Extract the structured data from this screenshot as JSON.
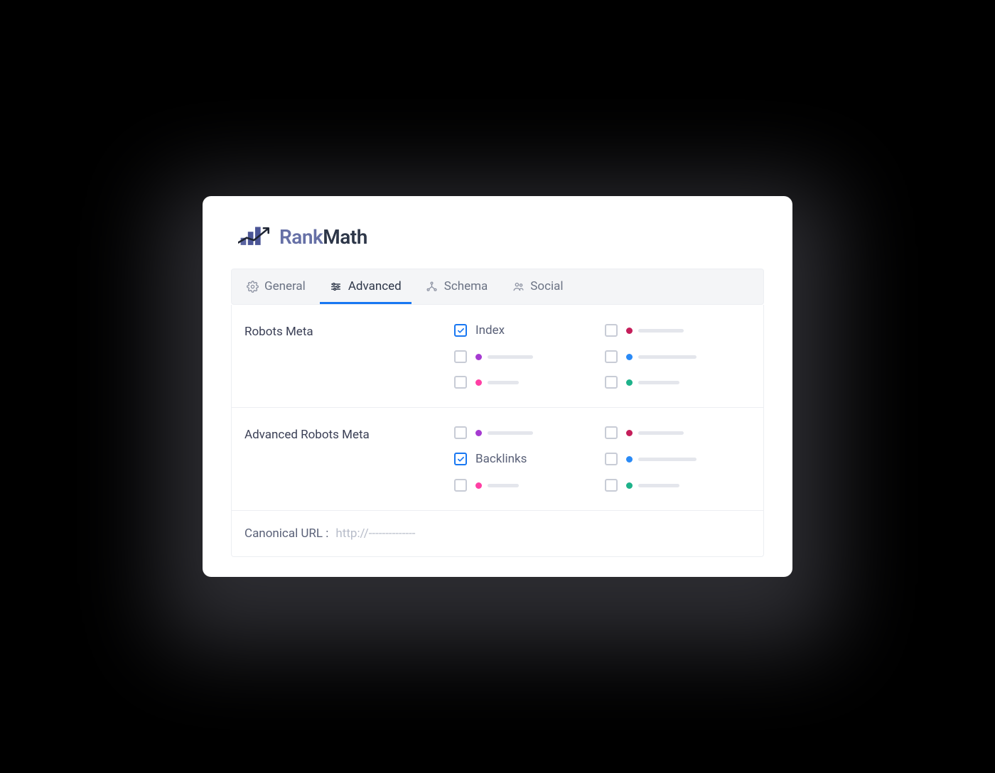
{
  "brand": {
    "rank": "Rank",
    "math": "Math"
  },
  "tabs": {
    "general": "General",
    "advanced": "Advanced",
    "schema": "Schema",
    "social": "Social"
  },
  "sections": {
    "robots": {
      "label": "Robots Meta",
      "items": {
        "left": [
          {
            "type": "text",
            "label": "Index",
            "checked": true
          },
          {
            "type": "ph",
            "dot": "#a63bd1",
            "bar": 64,
            "checked": false
          },
          {
            "type": "ph",
            "dot": "#ff3fa4",
            "bar": 44,
            "checked": false
          }
        ],
        "right": [
          {
            "type": "ph",
            "dot": "#c51e5a",
            "bar": 64,
            "checked": false
          },
          {
            "type": "ph",
            "dot": "#2a8af6",
            "bar": 82,
            "checked": false
          },
          {
            "type": "ph",
            "dot": "#1eb28a",
            "bar": 58,
            "checked": false
          }
        ]
      }
    },
    "advRobots": {
      "label": "Advanced Robots Meta",
      "items": {
        "left": [
          {
            "type": "ph",
            "dot": "#a63bd1",
            "bar": 64,
            "checked": false
          },
          {
            "type": "text",
            "label": "Backlinks",
            "checked": true
          },
          {
            "type": "ph",
            "dot": "#ff3fa4",
            "bar": 44,
            "checked": false
          }
        ],
        "right": [
          {
            "type": "ph",
            "dot": "#c51e5a",
            "bar": 64,
            "checked": false
          },
          {
            "type": "ph",
            "dot": "#2a8af6",
            "bar": 82,
            "checked": false
          },
          {
            "type": "ph",
            "dot": "#1eb28a",
            "bar": 58,
            "checked": false
          }
        ]
      }
    }
  },
  "canonical": {
    "label": "Canonical URL :",
    "placeholder": "http://--------------"
  }
}
